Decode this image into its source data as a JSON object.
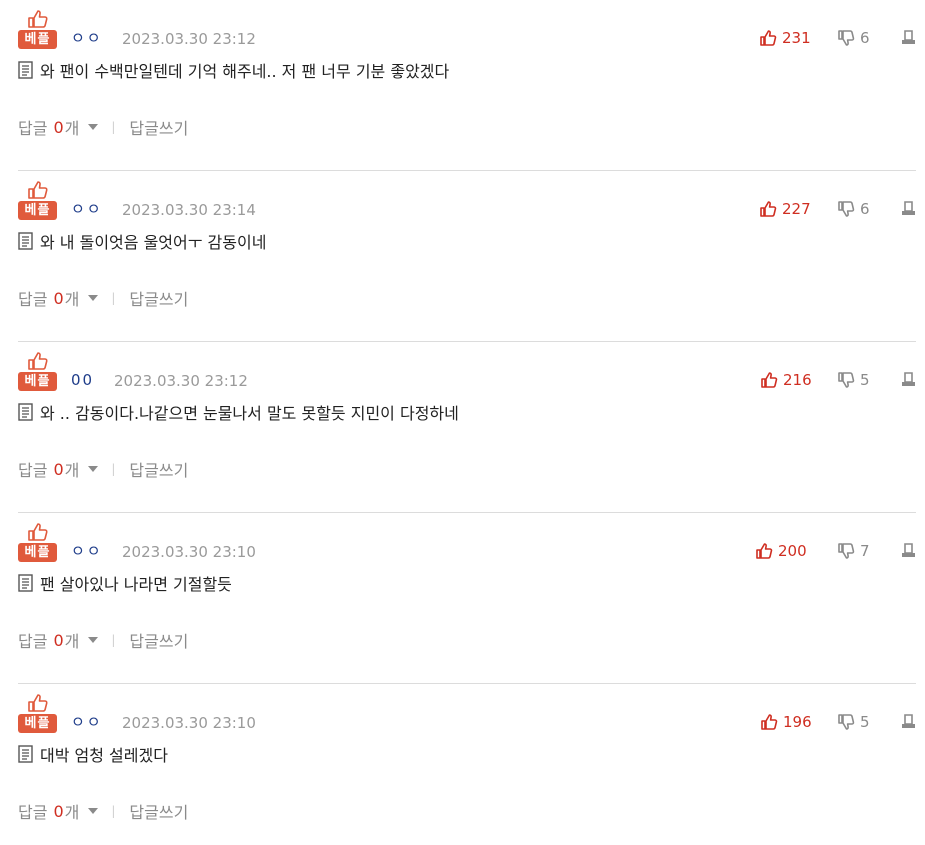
{
  "best_label": "베플",
  "reply_label": "답글",
  "reply_unit": "개",
  "write_reply_label": "답글쓰기",
  "colors": {
    "accent_red": "#cf2e21",
    "badge": "#e05a3c",
    "author": "#1f3d8a",
    "muted": "#9a9a9a"
  },
  "icons": {
    "best": "thumbs-up-icon",
    "up": "thumbs-up-outline-icon",
    "down": "thumbs-down-outline-icon",
    "report": "report-icon",
    "comment": "document-icon",
    "expand": "caret-down-icon"
  },
  "comments": [
    {
      "author": "ㅇㅇ",
      "date": "2023.03.30 23:12",
      "text": "와 팬이 수백만일텐데 기억 해주네.. 저 팬 너무 기분 좋았겠다",
      "up": "231",
      "down": "6",
      "replies": "0"
    },
    {
      "author": "ㅇㅇ",
      "date": "2023.03.30 23:14",
      "text": "와 내 돌이엇음 울엇어ㅜ 감동이네",
      "up": "227",
      "down": "6",
      "replies": "0"
    },
    {
      "author": "00",
      "date": "2023.03.30 23:12",
      "text": "와 .. 감동이다.나같으면 눈물나서 말도 못할듯 지민이 다정하네",
      "up": "216",
      "down": "5",
      "replies": "0"
    },
    {
      "author": "ㅇㅇ",
      "date": "2023.03.30 23:10",
      "text": "팬 살아있나 나라면 기절할듯",
      "up": "200",
      "down": "7",
      "replies": "0"
    },
    {
      "author": "ㅇㅇ",
      "date": "2023.03.30 23:10",
      "text": "대박 엄청 설레겠다",
      "up": "196",
      "down": "5",
      "replies": "0"
    }
  ]
}
